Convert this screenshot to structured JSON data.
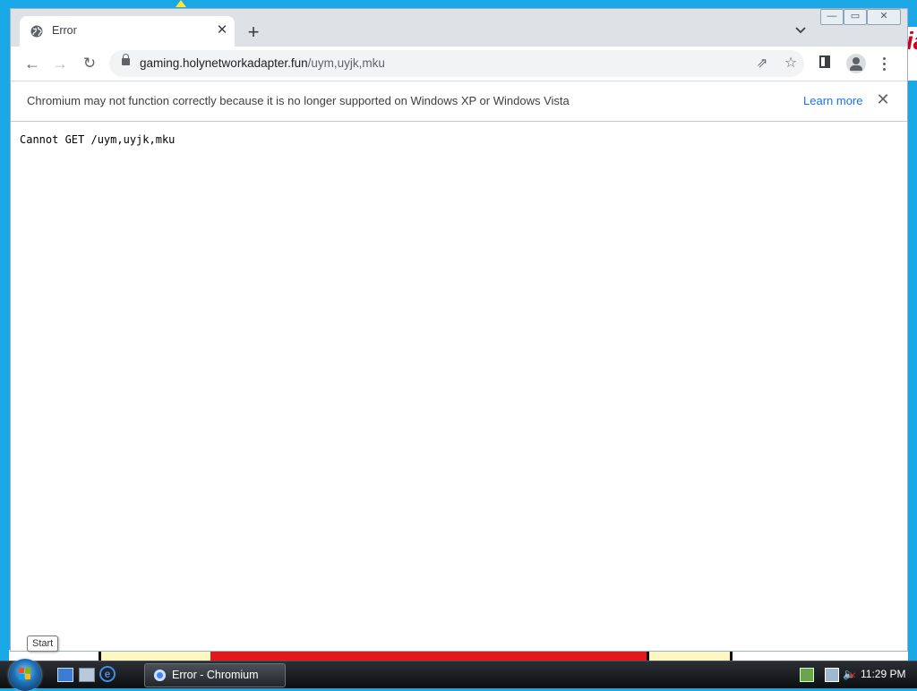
{
  "browser": {
    "tab": {
      "title": "Error",
      "icon": "globe-icon",
      "close_glyph": "✕"
    },
    "new_tab_glyph": "+",
    "tab_search_glyph": "⌄",
    "window_controls": {
      "minimize": "—",
      "maximize": "▭",
      "close": "✕"
    },
    "toolbar": {
      "back_glyph": "←",
      "forward_glyph": "→",
      "reload_glyph": "↻",
      "url_host": "gaming.holynetworkadapter.fun",
      "url_path": "/uym,uyjk,mku",
      "share_glyph": "⇗",
      "star_glyph": "☆"
    },
    "infobar": {
      "message": "Chromium may not function correctly because it is no longer supported on Windows XP or Windows Vista",
      "learn_more": "Learn more",
      "close_glyph": "✕"
    },
    "page": {
      "error_text": "Cannot GET /uym,uyjk,mku"
    }
  },
  "taskbar": {
    "start_tooltip": "Start",
    "task_button_label": "Error - Chromium",
    "clock": "11:29 PM"
  },
  "desktop": {
    "right_fragment_text": "ia"
  },
  "colors": {
    "desktop_bg": "#1aa7e6",
    "link": "#1a73e8",
    "tab_strip": "#dee1e6"
  }
}
